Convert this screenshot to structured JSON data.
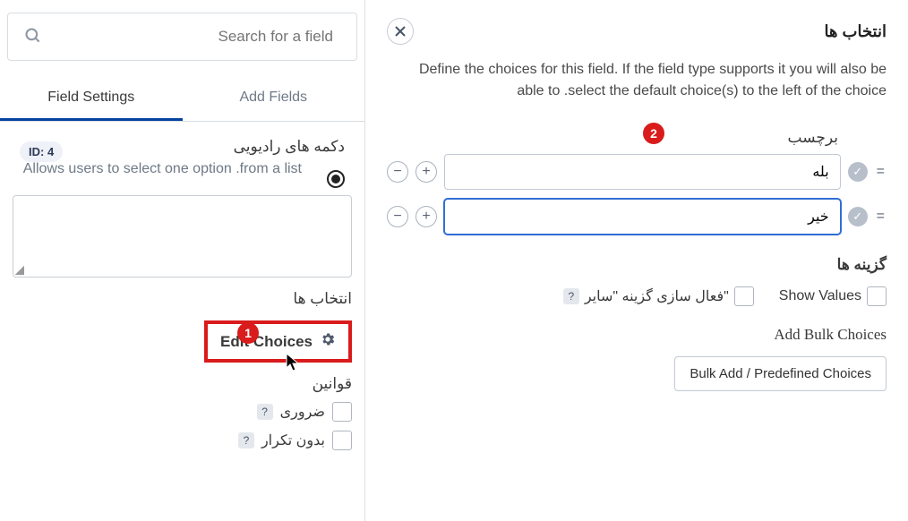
{
  "left": {
    "search_placeholder": "Search for a field",
    "tabs": {
      "field_settings": "Field Settings",
      "add_fields": "Add Fields"
    },
    "id_badge": "ID: 4",
    "field_title": "دکمه های رادیویی",
    "field_desc": "Allows users to select one option .from a list",
    "choices_label": "انتخاب ها",
    "edit_choices": "Edit Choices",
    "rules_label": "قوانین",
    "rule_required": "ضروری",
    "rule_unique": "بدون تکرار"
  },
  "right": {
    "title": "انتخاب ها",
    "desc": "Define the choices for this field. If the field type supports it you will also be able to .select the default choice(s) to the left of the choice",
    "col_label": "برچسب",
    "choices": [
      {
        "value": "بله",
        "focused": false
      },
      {
        "value": "خیر",
        "focused": true
      }
    ],
    "options_title": "گزینه ها",
    "show_values": "Show Values",
    "enable_other": "فعال سازی گزینه \"سایر\"",
    "bulk_title": "Add Bulk Choices",
    "bulk_button": "Bulk Add / Predefined Choices"
  },
  "badges": {
    "one": "1",
    "two": "2"
  }
}
